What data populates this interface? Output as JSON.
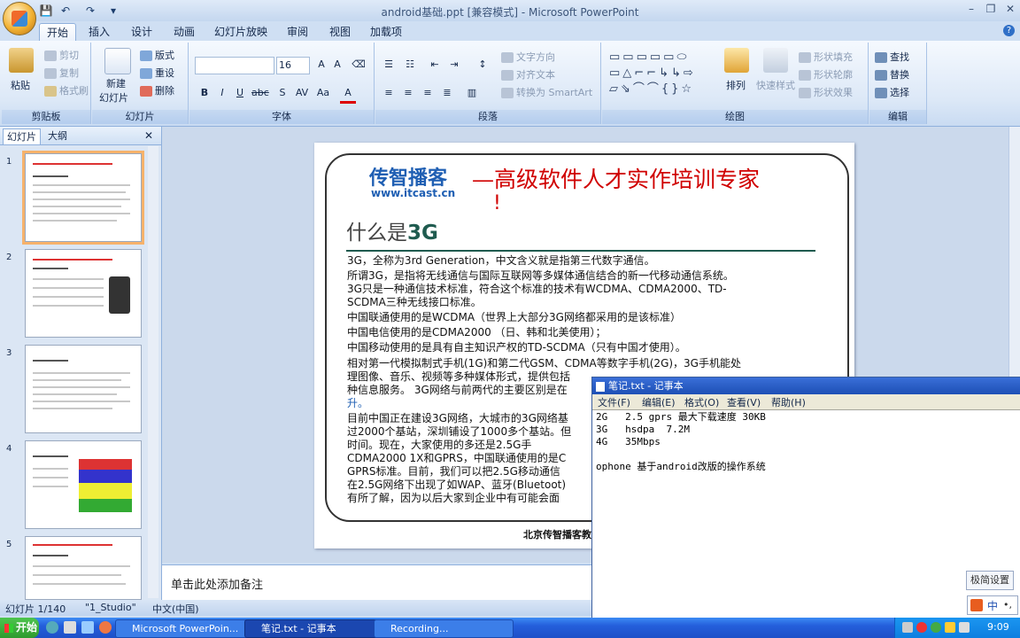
{
  "window": {
    "title": "android基础.ppt [兼容模式] - Microsoft PowerPoint"
  },
  "ribbon": {
    "tabs": [
      "开始",
      "插入",
      "设计",
      "动画",
      "幻灯片放映",
      "审阅",
      "视图",
      "加载项"
    ],
    "clipboard": {
      "paste": "粘贴",
      "cut": "剪切",
      "copy": "复制",
      "format_painter": "格式刷",
      "label": "剪贴板"
    },
    "slides": {
      "new_slide_line1": "新建",
      "new_slide_line2": "幻灯片",
      "layout": "版式",
      "reset": "重设",
      "delete": "删除",
      "label": "幻灯片"
    },
    "font": {
      "font_size": "16",
      "label": "字体"
    },
    "paragraph": {
      "text_direction": "文字方向",
      "align_text": "对齐文本",
      "smartart": "转换为 SmartArt",
      "label": "段落"
    },
    "drawing": {
      "arrange": "排列",
      "quick_styles": "快速样式",
      "shape_fill": "形状填充",
      "shape_outline": "形状轮廓",
      "shape_effects": "形状效果",
      "label": "绘图"
    },
    "editing": {
      "find": "查找",
      "replace": "替换",
      "select": "选择",
      "label": "编辑"
    }
  },
  "left_pane": {
    "tabs": [
      "幻灯片",
      "大纲"
    ],
    "slide_numbers": [
      "1",
      "2",
      "3",
      "4",
      "5"
    ]
  },
  "slide": {
    "logo_main": "传智播客",
    "logo_url": "www.itcast.cn",
    "slogan_line1": "—高级软件人才实作培训专家",
    "slogan_line2": "!",
    "heading_prefix": "什么是",
    "heading_bold": "3G",
    "lines": [
      "3G，全称为3rd Generation，中文含义就是指第三代数字通信。",
      "所谓3G，是指将无线通信与国际互联网等多媒体通信结合的新一代移动通信系统。",
      "3G只是一种通信技术标准，符合这个标准的技术有WCDMA、CDMA2000、TD-",
      "SCDMA三种无线接口标准。",
      "中国联通使用的是WCDMA（世界上大部分3G网络都采用的是该标准）",
      "中国电信使用的是CDMA2000 （日、韩和北美使用）；",
      "中国移动使用的是具有自主知识产权的TD-SCDMA（只有中国才使用）。",
      "相对第一代模拟制式手机(1G)和第二代GSM、CDMA等数字手机(2G)，3G手机能处",
      "理图像、音乐、视频等多种媒体形式，提供包括",
      "种信息服务。 3G网络与前两代的主要区别是在",
      "升。",
      "目前中国正在建设3G网络，大城市的3G网络基",
      "过2000个基站，深圳铺设了1000多个基站。但",
      "时间。现在，大家使用的多还是2.5G手",
      "CDMA2000 1X和GPRS，中国联通使用的是C",
      "GPRS标准。目前，我们可以把2.5G移动通信",
      "在2.5G网络下出现了如WAP、蓝牙(Bluetoot)",
      "有所了解，因为以后大家到企业中有可能会面"
    ],
    "footer": "北京传智播客教"
  },
  "notes": {
    "placeholder": "单击此处添加备注"
  },
  "status": {
    "slide_pos": "幻灯片 1/140",
    "theme": "\"1_Studio\"",
    "language": "中文(中国)"
  },
  "notepad": {
    "title": "笔记.txt - 记事本",
    "menu": [
      "文件(F)",
      "编辑(E)",
      "格式(O)",
      "查看(V)",
      "帮助(H)"
    ],
    "content_lines": [
      "2G   2.5 gprs 最大下载速度 30KB",
      "3G   hsdpa  7.2M",
      "4G   35Mbps",
      "",
      "ophone 基于android改版的操作系统"
    ]
  },
  "ime": {
    "settings_label": "极简设置",
    "mode": "中"
  },
  "taskbar": {
    "start": "开始",
    "tasks": [
      "Microsoft PowerPoin...",
      "笔记.txt - 记事本",
      "Recording..."
    ],
    "clock": "9:09"
  },
  "colors": {
    "accent": "#2f6fc7",
    "slogan_red": "#d00000",
    "logo_blue": "#1f5fb3",
    "logo_orange": "#e87c1e",
    "heading_rule": "#1f5b4f"
  }
}
